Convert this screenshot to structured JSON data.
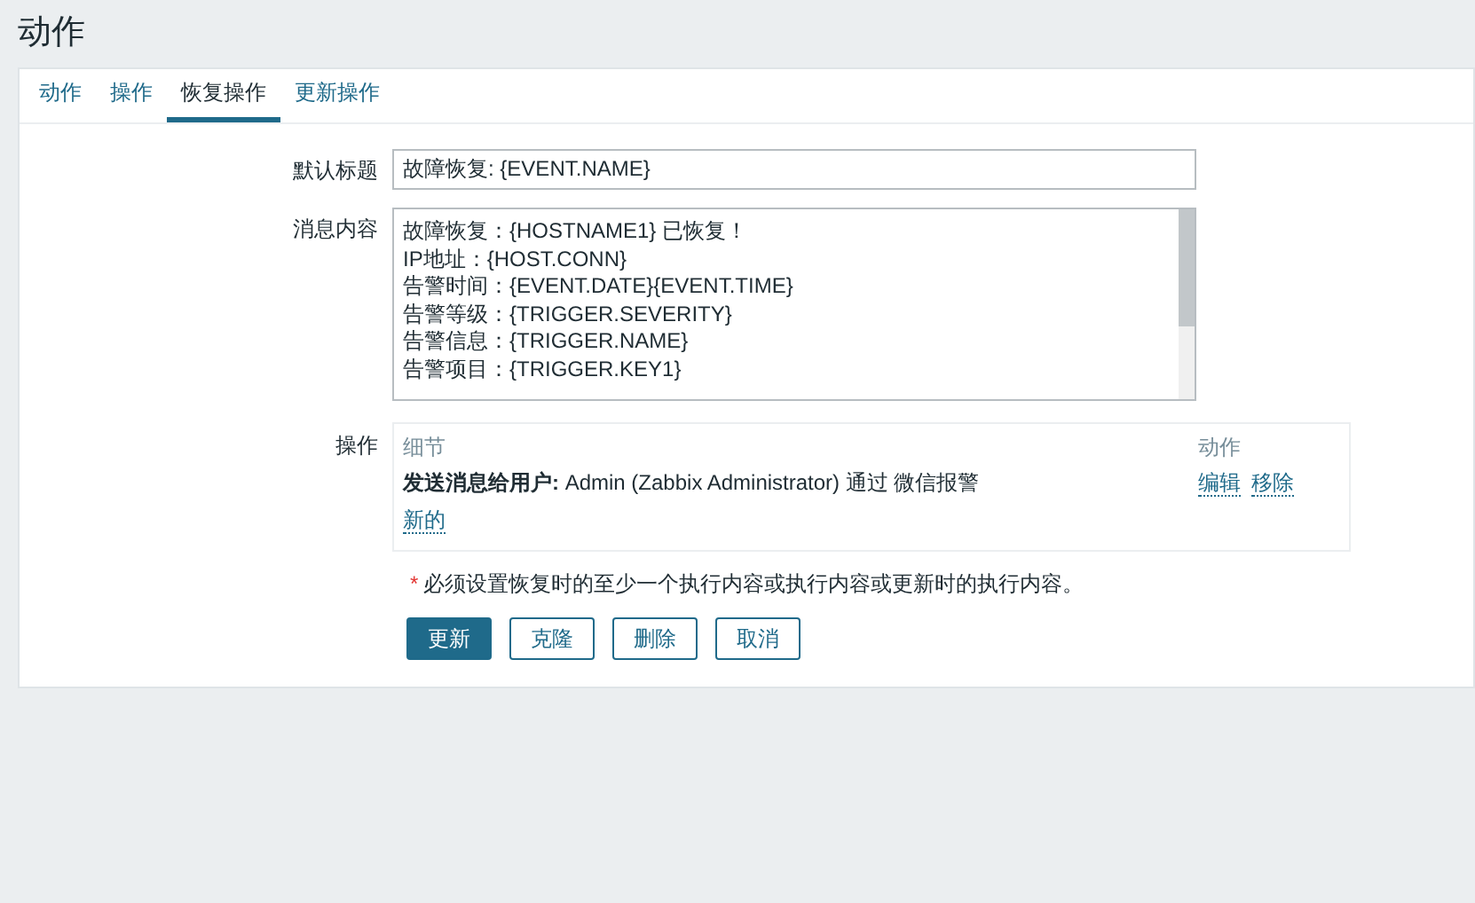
{
  "page_title": "动作",
  "tabs": [
    {
      "label": "动作",
      "selected": false
    },
    {
      "label": "操作",
      "selected": false
    },
    {
      "label": "恢复操作",
      "selected": true
    },
    {
      "label": "更新操作",
      "selected": false
    }
  ],
  "form": {
    "default_subject": {
      "label": "默认标题",
      "value": "故障恢复: {EVENT.NAME}"
    },
    "message": {
      "label": "消息内容",
      "lines": [
        "故障恢复：{HOSTNAME1} 已恢复！",
        "IP地址：{HOST.CONN}",
        "告警时间：{EVENT.DATE}{EVENT.TIME}",
        "告警等级：{TRIGGER.SEVERITY}",
        "告警信息：{TRIGGER.NAME}",
        "告警项目：{TRIGGER.KEY1}"
      ]
    },
    "operations": {
      "label": "操作",
      "columns": [
        "细节",
        "动作"
      ],
      "rows": [
        {
          "details": "**发送消息给用户:** Admin (Zabbix Administrator) 通过 微信报警",
          "actions": [
            "编辑",
            "移除"
          ]
        }
      ],
      "new_link": "新的"
    },
    "note_mark": "*",
    "note": "必须设置恢复时的至少一个执行内容或执行内容或更新时的执行内容。",
    "buttons": [
      {
        "label": "更新",
        "kind": "primary"
      },
      {
        "label": "克隆",
        "kind": "secondary"
      },
      {
        "label": "删除",
        "kind": "secondary"
      },
      {
        "label": "取消",
        "kind": "secondary"
      }
    ]
  }
}
